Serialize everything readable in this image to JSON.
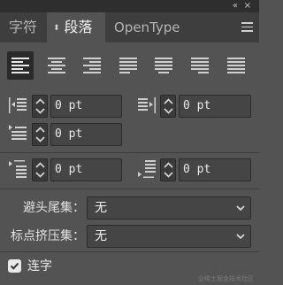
{
  "window": {
    "collapse_glyph": "«",
    "close_glyph": "×"
  },
  "tabs": [
    {
      "label": "字符",
      "active": false
    },
    {
      "label": "段落",
      "active": true,
      "icon": "up-down-arrows-icon"
    },
    {
      "label": "OpenType",
      "active": false
    }
  ],
  "alignment": {
    "buttons": [
      {
        "name": "align-left-button",
        "icon": "align-left-icon",
        "selected": true
      },
      {
        "name": "align-center-button",
        "icon": "align-center-icon",
        "selected": false
      },
      {
        "name": "align-right-button",
        "icon": "align-right-icon",
        "selected": false
      },
      {
        "name": "justify-last-left-button",
        "icon": "justify-last-left-icon",
        "selected": false
      },
      {
        "name": "justify-last-center-button",
        "icon": "justify-last-center-icon",
        "selected": false
      },
      {
        "name": "justify-last-right-button",
        "icon": "justify-last-right-icon",
        "selected": false
      },
      {
        "name": "justify-all-button",
        "icon": "justify-all-icon",
        "selected": false
      }
    ]
  },
  "indents": {
    "left_indent": "0 pt",
    "right_indent": "0 pt",
    "first_line_indent": "0 pt"
  },
  "spacing": {
    "space_before": "0 pt",
    "space_after": "0 pt"
  },
  "kinsoku": {
    "label": "避头尾集：",
    "value": "无"
  },
  "mojikumi": {
    "label": "标点挤压集：",
    "value": "无"
  },
  "hyphenate": {
    "label": "连字",
    "checked": true
  },
  "watermark": "@稀土掘金技术社区",
  "colors": {
    "panel_bg": "#535353",
    "tab_bar_bg": "#3e3e3e",
    "input_bg": "#454545",
    "selected_button_bg": "#2a2a2a"
  }
}
